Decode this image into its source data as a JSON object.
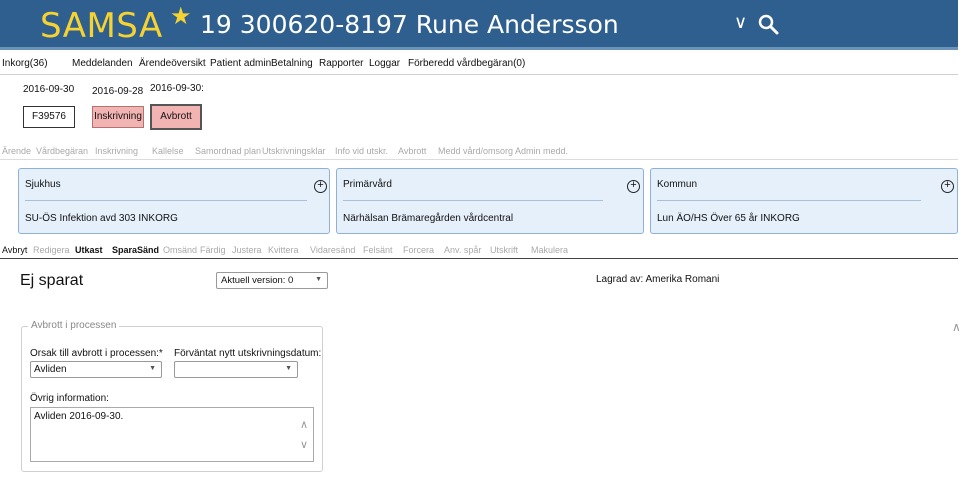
{
  "header": {
    "brand": "SAMSA",
    "star_icon": "star-icon",
    "patient": "19 300620-8197 Rune Andersson",
    "menu_icon": "chevron-down-icon",
    "search_icon": "search-icon",
    "bg_color": "#2e5f8f",
    "brand_color": "#f6d232"
  },
  "menu": {
    "items": [
      "Inkorg(36)",
      "Meddelanden",
      "Ärendeöversikt",
      "Patient admin",
      "Betalning",
      "Rapporter",
      "Loggar",
      "Förberedd vårdbegäran(0)"
    ]
  },
  "episodes": {
    "e1_date": "2016-09-30",
    "e1_label": "F39576",
    "e2_date": "2016-09-28",
    "e2_label": "Inskrivning",
    "e3_date": "2016-09-30:",
    "e3_label": "Avbrott"
  },
  "tabs_top": {
    "items": [
      "Ärende",
      "Vårdbegäran",
      "Inskrivning",
      "Kallelse",
      "Samordnad plan",
      "Utskrivningsklar",
      "Info vid utskr.",
      "Avbrott",
      "Medd vård/omsorg",
      "Admin medd."
    ]
  },
  "orgs": {
    "sjukhus_title": "Sjukhus",
    "sjukhus_val": "SU-ÖS Infektion avd 303 INKORG",
    "primar_title": "Primärvård",
    "primar_val": "Närhälsan Brämaregården vårdcentral",
    "kommun_title": "Kommun",
    "kommun_val": "Lun ÄO/HS Över 65 år INKORG",
    "plus_icon": "plus-circle-icon"
  },
  "tabs_actions": {
    "items": [
      "Avbryt",
      "Redigera",
      "Utkast",
      "SparaSänd",
      "Omsänd",
      "Färdig",
      "Justera",
      "Kvittera",
      "Vidaresänd",
      "Felsänt",
      "Forcera",
      "Anv. spår",
      "Utskrift",
      "Makulera"
    ]
  },
  "status": {
    "title": "Ej sparat",
    "version": "Aktuell version: 0",
    "saved_by": "Lagrad av: Amerika Romani"
  },
  "form": {
    "legend": "Avbrott i processen",
    "reason_label": "Orsak till avbrott i processen:*",
    "reason_value": "Avliden",
    "date_label": "Förväntat nytt utskrivningsdatum:",
    "date_value": "",
    "other_label": "Övrig information:",
    "other_value": "Avliden 2016-09-30."
  }
}
